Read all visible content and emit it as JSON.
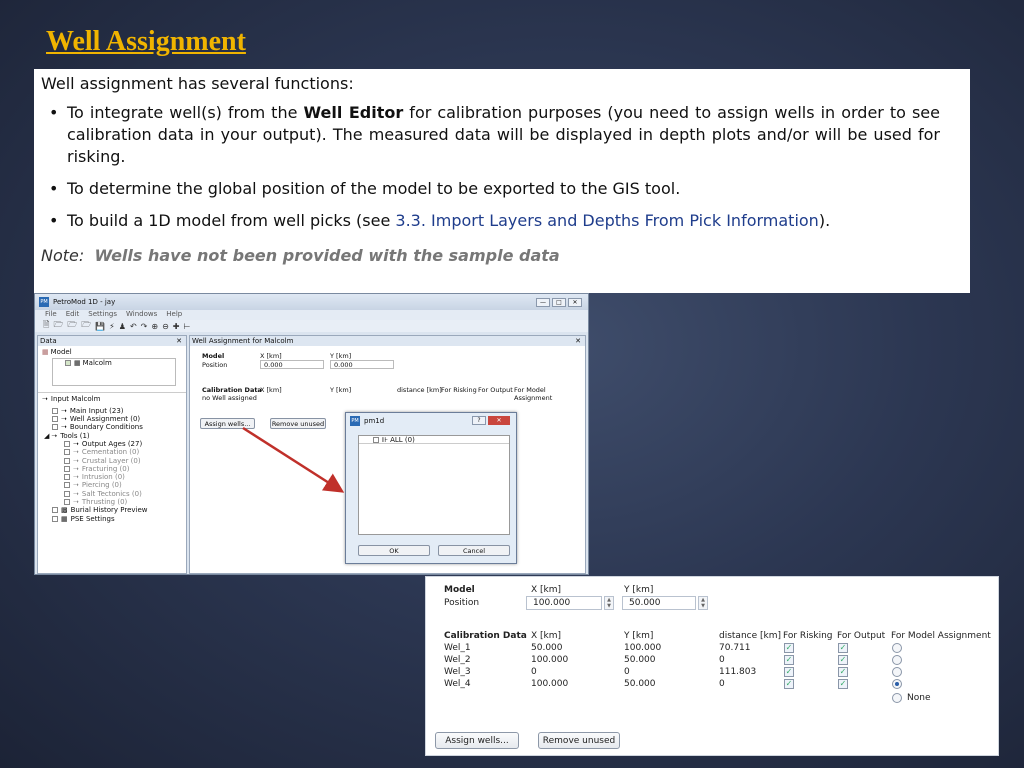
{
  "slide": {
    "title": "Well Assignment"
  },
  "description": {
    "intro": "Well assignment has several functions:",
    "bullet1_before": "To integrate well(s) from the ",
    "bullet1_bold": "Well Editor",
    "bullet1_after": " for calibration purposes (you need to assign wells in order to see calibration data in your output). The measured data will be displayed in depth plots and/or will be used for risking.",
    "bullet2": "To determine the global position of the model to be exported to the GIS tool.",
    "bullet3_before": "To build a 1D model from well picks (see ",
    "bullet3_link": "3.3. Import Layers and Depths From Pick Information",
    "bullet3_after": ").",
    "note_label": "Note:",
    "note_text": "Wells have not been provided with the sample data"
  },
  "app": {
    "window_title": "PetroMod 1D - jay",
    "menu": [
      "File",
      "Edit",
      "Settings",
      "Windows",
      "Help"
    ],
    "data_panel_title": "Data",
    "model_label": "Model",
    "model_item": "Malcolm",
    "input_label": "Input Malcolm",
    "tree": [
      {
        "label": "Main Input (23)",
        "dim": false
      },
      {
        "label": "Well Assignment (0)",
        "dim": false
      },
      {
        "label": "Boundary Conditions",
        "dim": false
      },
      {
        "label": "Tools (1)",
        "dim": false
      },
      {
        "label": "Output Ages (27)",
        "dim": false
      },
      {
        "label": "Cementation (0)",
        "dim": true
      },
      {
        "label": "Crustal Layer (0)",
        "dim": true
      },
      {
        "label": "Fracturing (0)",
        "dim": true
      },
      {
        "label": "Intrusion (0)",
        "dim": true
      },
      {
        "label": "Piercing (0)",
        "dim": true
      },
      {
        "label": "Salt Tectonics (0)",
        "dim": true
      },
      {
        "label": "Thrusting (0)",
        "dim": true
      },
      {
        "label": "Burial History Preview",
        "dim": false
      },
      {
        "label": "PSE Settings",
        "dim": false
      }
    ],
    "right_panel_title": "Well Assignment for Malcolm",
    "model_heading": "Model",
    "x_label": "X [km]",
    "y_label": "Y [km]",
    "position_label": "Position",
    "pos_x": "0.000",
    "pos_y": "0.000",
    "calibration_heading": "Calibration Data",
    "distance_label": "distance [km]",
    "risking_label": "For Risking",
    "output_label": "For Output",
    "model_assign_label": "For Model Assignment",
    "no_well": "no Well assigned",
    "assign_button": "Assign wells...",
    "remove_button": "Remove unused",
    "dialog": {
      "title": "pm1d",
      "all_item": "ALL (0)",
      "ok": "OK",
      "cancel": "Cancel"
    }
  },
  "zoom": {
    "model_heading": "Model",
    "x_label": "X [km]",
    "y_label": "Y [km]",
    "position_label": "Position",
    "pos_x": "100.000",
    "pos_y": "50.000",
    "calibration_heading": "Calibration Data",
    "distance_label": "distance [km]",
    "risking_label": "For Risking",
    "output_label": "For Output",
    "model_assign_label": "For Model Assignment",
    "wells": [
      {
        "name": "Wel_1",
        "x": "50.000",
        "y": "100.000",
        "distance": "70.711",
        "selected": false
      },
      {
        "name": "Wel_2",
        "x": "100.000",
        "y": "50.000",
        "distance": "0",
        "selected": false
      },
      {
        "name": "Wel_3",
        "x": "0",
        "y": "0",
        "distance": "111.803",
        "selected": false
      },
      {
        "name": "Wel_4",
        "x": "100.000",
        "y": "50.000",
        "distance": "0",
        "selected": true
      }
    ],
    "none_label": "None",
    "assign_button": "Assign wells...",
    "remove_button": "Remove unused"
  }
}
